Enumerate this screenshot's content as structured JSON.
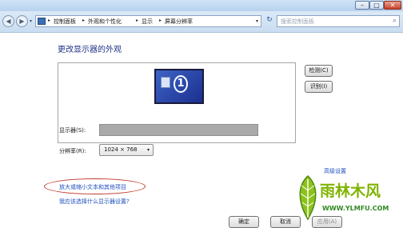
{
  "window": {
    "controls": {
      "minimize": "–",
      "maximize": "□",
      "close": "✕"
    }
  },
  "nav": {
    "back_glyph": "◀",
    "forward_glyph": "▶",
    "history_glyph": "▾",
    "breadcrumb": [
      "控制面板",
      "外观和个性化",
      "显示",
      "屏幕分辨率"
    ],
    "separator": "▸",
    "address_dropdown": "▾",
    "refresh_glyph": "↻",
    "search_placeholder": "搜索控制面板",
    "search_glyph": "⌕"
  },
  "main": {
    "title": "更改显示器的外观",
    "monitor_number": "1",
    "detect_label": "检测(C)",
    "identify_label": "识别(I)",
    "display_label": "显示器(S):",
    "resolution_label": "分辨率(R):",
    "resolution_value": "1024 × 768",
    "resolution_arrow": "▾",
    "advanced_link": "高级设置",
    "text_size_link": "放大或缩小文本和其他项目",
    "which_settings_link": "我应该选择什么显示器设置?"
  },
  "footer": {
    "ok_label": "确定",
    "cancel_label": "取消",
    "apply_label": "应用(A)"
  },
  "watermark": {
    "logo_text": "雨林木风",
    "url": "WWW.YLMFU.COM"
  },
  "colors": {
    "title_text": "#1e3287",
    "link": "#1f4fbf",
    "highlight_oval": "#c0392b",
    "monitor_blue": "#2a45a8"
  }
}
